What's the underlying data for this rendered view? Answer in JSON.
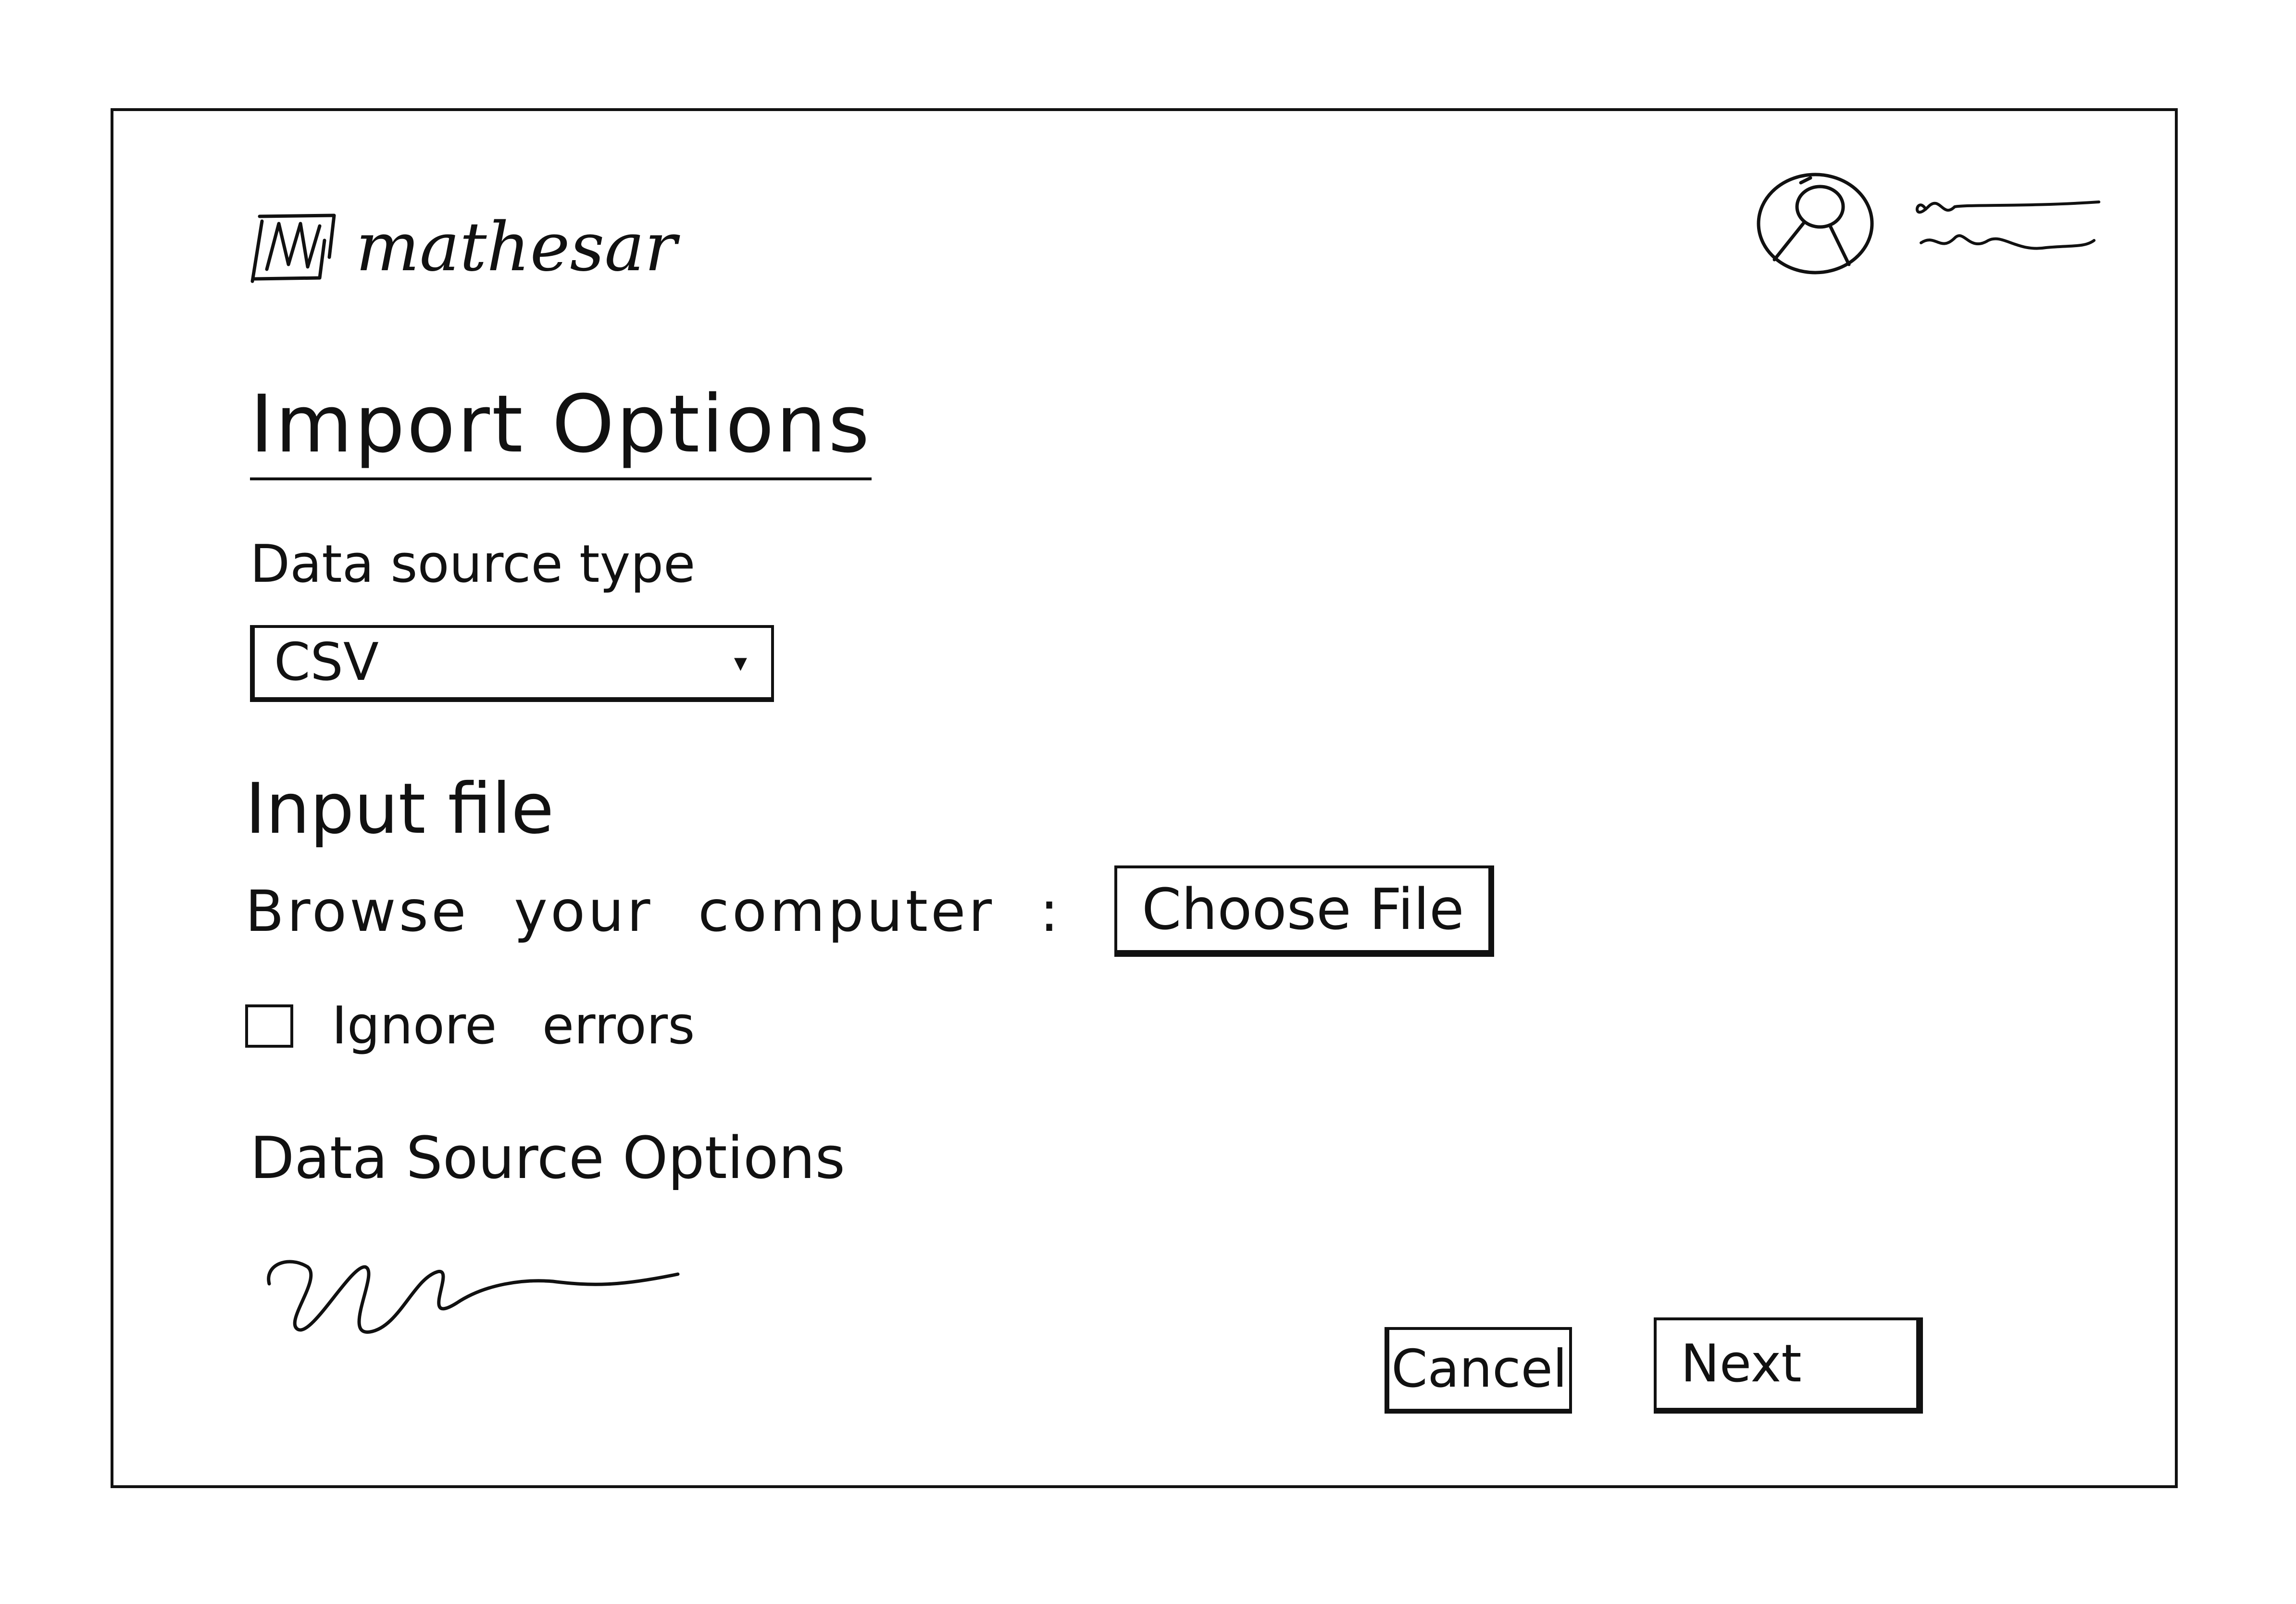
{
  "header": {
    "logo_text": "mathesar",
    "logo_icon": "mathesar-logo-icon",
    "avatar_icon": "user-avatar-icon",
    "user_name_placeholder": "scribble"
  },
  "main": {
    "title": "Import Options",
    "data_source_type": {
      "label": "Data source type",
      "selected_value": "CSV",
      "arrow": "▾"
    },
    "input_file": {
      "heading": "Input file",
      "browse_label": "Browse your computer :",
      "choose_file_label": "Choose File"
    },
    "ignore_errors": {
      "label": "Ignore errors",
      "checked": false
    },
    "data_source_options": {
      "heading": "Data Source Options",
      "content_placeholder": "scribble"
    }
  },
  "footer": {
    "cancel_label": "Cancel",
    "next_label": "Next"
  }
}
